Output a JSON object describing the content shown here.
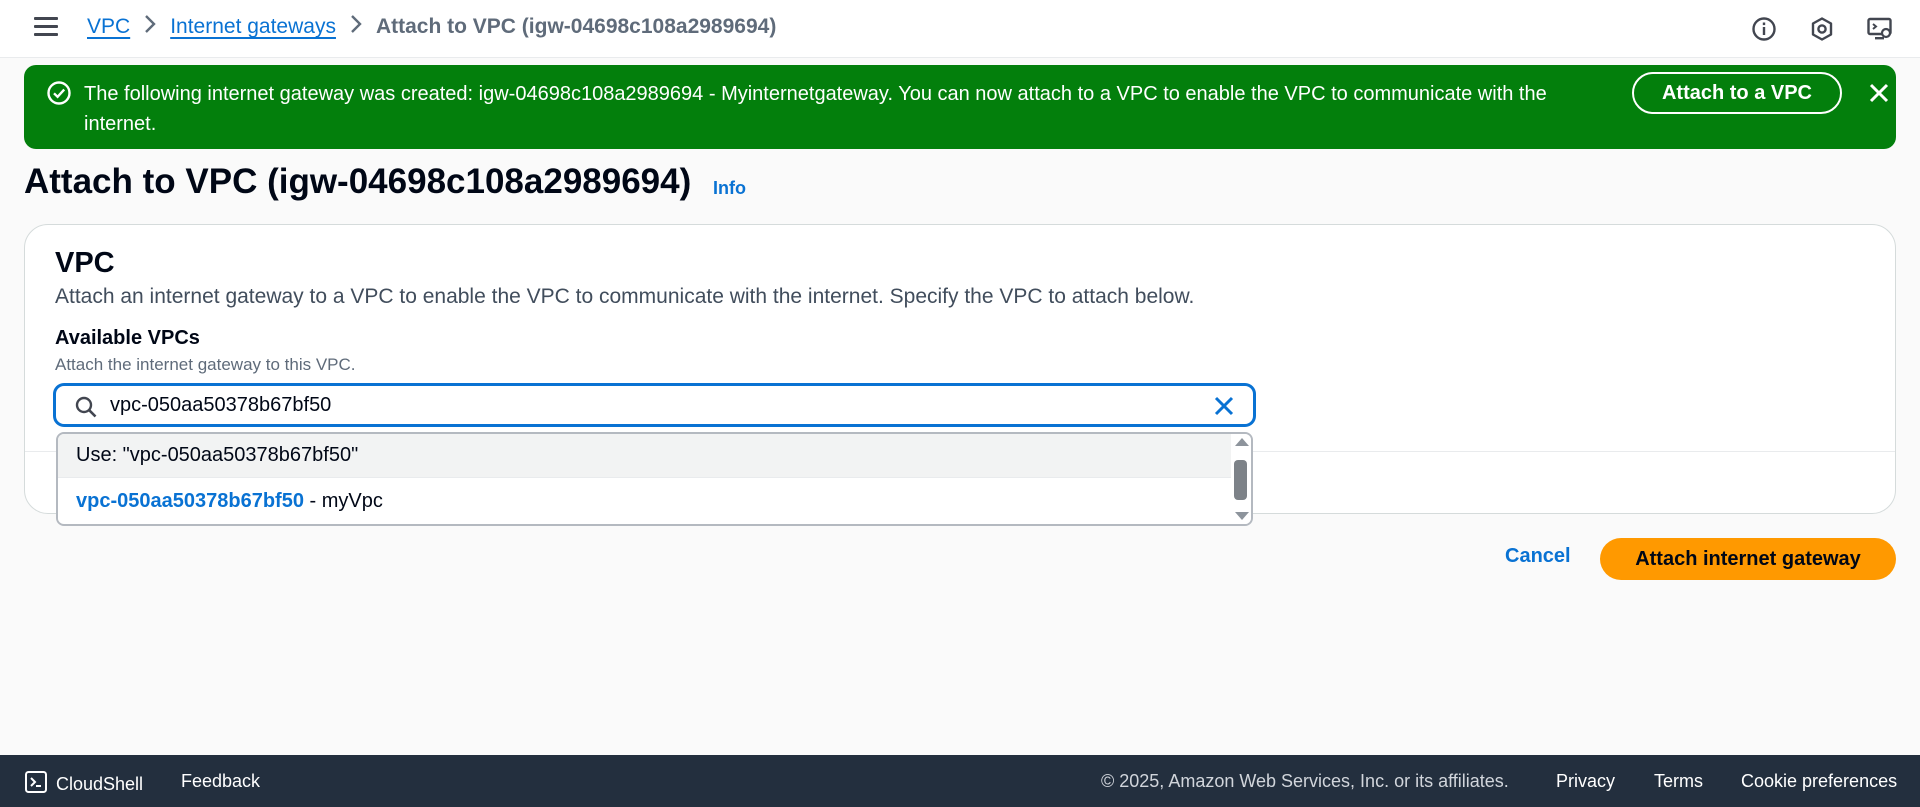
{
  "breadcrumb": {
    "items": [
      {
        "label": "VPC"
      },
      {
        "label": "Internet gateways"
      }
    ],
    "current": "Attach to VPC (igw-04698c108a2989694)"
  },
  "top_icons": [
    "info-icon",
    "notifications-icon",
    "settings-icon"
  ],
  "flash": {
    "message": "The following internet gateway was created: igw-04698c108a2989694 - Myinternetgateway. You can now attach to a VPC to enable the VPC to communicate with the internet.",
    "action_label": "Attach to a VPC",
    "color": "#037f0c"
  },
  "page": {
    "title": "Attach to VPC (igw-04698c108a2989694)",
    "info_label": "Info"
  },
  "section": {
    "title": "VPC",
    "description": "Attach an internet gateway to a VPC to enable the VPC to communicate with the internet. Specify the VPC to attach below."
  },
  "field": {
    "label": "Available VPCs",
    "description": "Attach the internet gateway to this VPC.",
    "value": "vpc-050aa50378b67bf50"
  },
  "dropdown": {
    "use_option": "Use: \"vpc-050aa50378b67bf50\"",
    "option_id": "vpc-050aa50378b67bf50",
    "option_suffix": " - myVpc"
  },
  "actions": {
    "cancel_label": "Cancel",
    "primary_label": "Attach internet gateway",
    "primary_color": "#ff9900",
    "link_color": "#0972d3"
  },
  "footer": {
    "cloudshell_label": "CloudShell",
    "feedback_label": "Feedback",
    "copyright": "© 2025, Amazon Web Services, Inc. or its affiliates.",
    "privacy_label": "Privacy",
    "terms_label": "Terms",
    "cookie_label": "Cookie preferences"
  }
}
